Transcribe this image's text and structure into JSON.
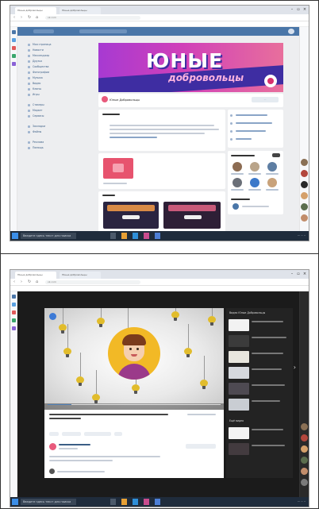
{
  "browser": {
    "tabs": [
      "Юные добровольцы",
      "Юные добровольцы"
    ],
    "url": "vk.com"
  },
  "vk_group": {
    "cover_title": "ЮНЫЕ",
    "cover_subtitle": "добровольцы",
    "group_name": "Юные Добровольцы",
    "menu": [
      "Моя страница",
      "Новости",
      "Мессенджер",
      "Друзья",
      "Сообщества",
      "Фотографии",
      "Музыка",
      "Видео",
      "Клипы",
      "Игры",
      "Стикеры",
      "Маркет",
      "Сервисы",
      "Закладки",
      "Файлы",
      "Реклама",
      "Помощь"
    ]
  },
  "video_page": {
    "sidebar_title": "Видео Юные Добровольцы",
    "more_title": "Ещё видео"
  },
  "taskbar": {
    "search_placeholder": "Введите здесь текст для поиска"
  },
  "colors": {
    "vk_blue": "#4a76a8",
    "cover_pink": "#d040b9",
    "cover_violet": "#3e2da2",
    "bulb_yellow": "#e1bc2c",
    "taskbar": "#1f2c3c"
  }
}
